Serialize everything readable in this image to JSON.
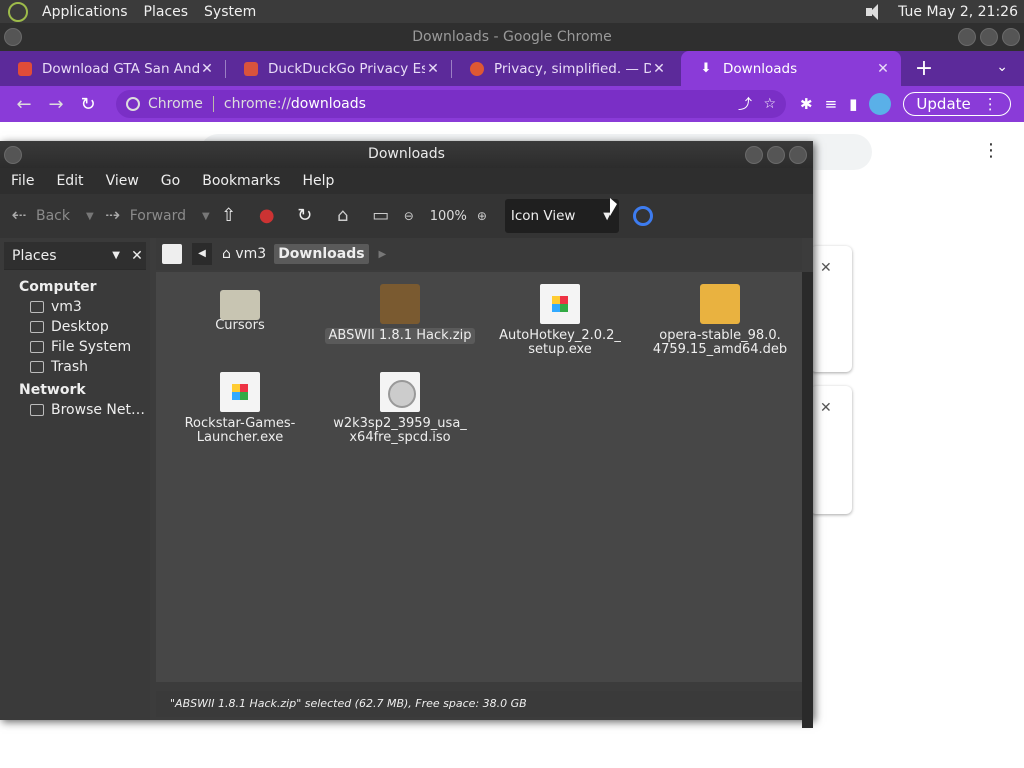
{
  "panel": {
    "menus": [
      "Applications",
      "Places",
      "System"
    ],
    "clock": "Tue May  2, 21:26"
  },
  "chrome": {
    "window_title": "Downloads - Google Chrome",
    "tabs": [
      {
        "title": "Download GTA San Andreas",
        "active": false,
        "favicon_color": "#e14c38"
      },
      {
        "title": "DuckDuckGo Privacy Essa",
        "active": false,
        "favicon_color": "#d9533c"
      },
      {
        "title": "Privacy, simplified. — Duck",
        "active": false,
        "favicon_color": "#de5833"
      },
      {
        "title": "Downloads",
        "active": true,
        "favicon_color": "#ffffff"
      }
    ],
    "new_tab": "+",
    "omnibox": {
      "chip": "Chrome",
      "scheme": "chrome://",
      "path": "downloads"
    },
    "update_label": "Update",
    "accent": "#8a3bd8",
    "tabbar_color": "#5c2a9a"
  },
  "fm": {
    "title": "Downloads",
    "menus": [
      "File",
      "Edit",
      "View",
      "Go",
      "Bookmarks",
      "Help"
    ],
    "toolbar": {
      "back": "Back",
      "forward": "Forward",
      "zoom": "100%",
      "view_mode": "Icon View"
    },
    "sidebar": {
      "header": "Places",
      "groups": [
        {
          "label": "Computer",
          "items": [
            "vm3",
            "Desktop",
            "File System",
            "Trash"
          ]
        },
        {
          "label": "Network",
          "items": [
            "Browse Net…"
          ]
        }
      ]
    },
    "path": [
      "vm3",
      "Downloads"
    ],
    "files": [
      {
        "name1": "Cursors",
        "name2": "",
        "type": "folder",
        "selected": false
      },
      {
        "name1": "ABSWII 1.8.1 Hack.zip",
        "name2": "",
        "type": "zip",
        "selected": true
      },
      {
        "name1": "AutoHotkey_2.0.2_",
        "name2": "setup.exe",
        "type": "exe",
        "selected": false
      },
      {
        "name1": "opera-stable_98.0.",
        "name2": "4759.15_amd64.deb",
        "type": "deb",
        "selected": false
      },
      {
        "name1": "Rockstar-Games-",
        "name2": "Launcher.exe",
        "type": "exe",
        "selected": false
      },
      {
        "name1": "w2k3sp2_3959_usa_",
        "name2": "x64fre_spcd.iso",
        "type": "iso",
        "selected": false
      }
    ],
    "status": "\"ABSWII 1.8.1 Hack.zip\" selected (62.7 MB), Free space: 38.0 GB"
  }
}
